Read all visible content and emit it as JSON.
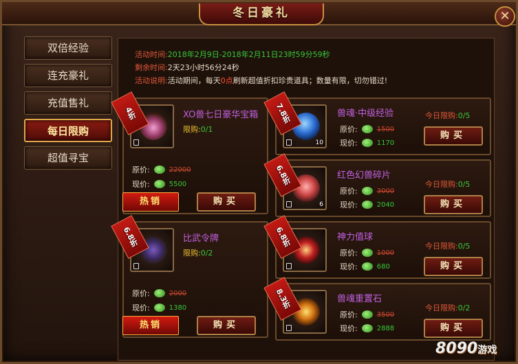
{
  "window": {
    "title": "冬日豪礼",
    "close_label": "✕"
  },
  "sidebar": {
    "items": [
      {
        "label": "双倍经验",
        "active": false
      },
      {
        "label": "连充豪礼",
        "active": false
      },
      {
        "label": "充值售礼",
        "active": false
      },
      {
        "label": "每日限购",
        "active": true
      },
      {
        "label": "超值寻宝",
        "active": false
      }
    ]
  },
  "info": {
    "time_label": "活动时间:",
    "time_value": "2018年2月9日-2018年2月11日23时59分59秒",
    "remain_label": "剩余时间:",
    "remain_value": "2天23小时56分24秒",
    "desc_label": "活动说明:",
    "desc_pre": "活动期间，每天",
    "desc_highlight": "0点",
    "desc_post": "刷新超值折扣珍贵道具；数量有限，切勿错过!"
  },
  "labels": {
    "original_price": "原价:",
    "current_price": "现价:",
    "buy": "购买",
    "hot": "热销",
    "limit": "限购:",
    "today_limit": "今日限购:"
  },
  "large_items": [
    {
      "discount": "4折",
      "name": "XO兽七日豪华宝箱",
      "limit": "0/1",
      "old_price": "22000",
      "new_price": "5500",
      "icon": "treasure-chest-icon"
    },
    {
      "discount": "6.8折",
      "name": "比武令牌",
      "limit": "0/2",
      "old_price": "2000",
      "new_price": "1380",
      "icon": "token-icon"
    }
  ],
  "small_items": [
    {
      "discount": "7.8折",
      "name": "兽魂·中级经验",
      "today": "0/5",
      "old_price": "1500",
      "new_price": "1170",
      "qty": "10",
      "icon": "exp-orb-icon",
      "color": "#c060e0"
    },
    {
      "discount": "6.8折",
      "name": "红色幻兽碎片",
      "today": "0/5",
      "old_price": "3000",
      "new_price": "2040",
      "qty": "6",
      "icon": "crystal-shard-icon",
      "color": "#c060e0"
    },
    {
      "discount": "6.8折",
      "name": "神力值球",
      "today": "0/5",
      "old_price": "1000",
      "new_price": "680",
      "qty": "",
      "icon": "power-orb-icon",
      "color": "#c060e0"
    },
    {
      "discount": "8.3折",
      "name": "兽魂重置石",
      "today": "0/2",
      "old_price": "3500",
      "new_price": "2888",
      "qty": "",
      "icon": "reset-stone-icon",
      "color": "#c060e0"
    }
  ],
  "watermark": {
    "text": "8090",
    "sub": "游戏"
  },
  "colors": {
    "accent_green": "#37c83a",
    "accent_red": "#e05838",
    "gold": "#c9923f"
  }
}
